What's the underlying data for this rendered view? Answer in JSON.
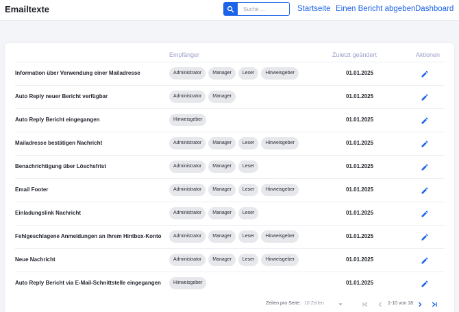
{
  "header": {
    "title": "Emailtexte",
    "search_placeholder": "Suche ...",
    "nav": [
      "Startseite",
      "Einen Bericht abgeben",
      "Dashboard"
    ]
  },
  "table": {
    "columns": {
      "recipients": "Empfänger",
      "last_changed": "Zuletzt geändert",
      "actions": "Aktionen"
    },
    "rows": [
      {
        "name": "Information über Verwendung einer Mailadresse",
        "recipients": [
          "Administrator",
          "Manager",
          "Leser",
          "Hinweisgeber"
        ],
        "date": "01.01.2025"
      },
      {
        "name": "Auto Reply neuer Bericht verfügbar",
        "recipients": [
          "Administrator",
          "Manager"
        ],
        "date": "01.01.2025"
      },
      {
        "name": "Auto Reply Bericht eingegangen",
        "recipients": [
          "Hinweisgeber"
        ],
        "date": "01.01.2025"
      },
      {
        "name": "Mailadresse bestätigen Nachricht",
        "recipients": [
          "Administrator",
          "Manager",
          "Leser",
          "Hinweisgeber"
        ],
        "date": "01.01.2025"
      },
      {
        "name": "Benachrichtigung über Löschsfrist",
        "recipients": [
          "Administrator",
          "Manager",
          "Leser"
        ],
        "date": "01.01.2025"
      },
      {
        "name": "Email Footer",
        "recipients": [
          "Administrator",
          "Manager",
          "Leser",
          "Hinweisgeber"
        ],
        "date": "01.01.2025"
      },
      {
        "name": "Einladungslink Nachricht",
        "recipients": [
          "Administrator",
          "Manager",
          "Leser"
        ],
        "date": "01.01.2025"
      },
      {
        "name": "Fehlgeschlagene Anmeldungen an Ihrem Hintbox-Konto",
        "recipients": [
          "Administrator",
          "Manager",
          "Leser",
          "Hinweisgeber"
        ],
        "date": "01.01.2025"
      },
      {
        "name": "Neue Nachricht",
        "recipients": [
          "Administrator",
          "Manager",
          "Leser",
          "Hinweisgeber"
        ],
        "date": "01.01.2025"
      },
      {
        "name": "Auto Reply Bericht via E-Mail-Schnittstelle eingegangen",
        "recipients": [
          "Hinweisgeber"
        ],
        "date": "01.01.2025"
      }
    ]
  },
  "pagination": {
    "rows_per_page_label": "Zeilen pro Seite:",
    "rows_per_page_value": "10 Zeilen",
    "range": "1-10 von 18"
  },
  "colors": {
    "accent": "#1d63e8",
    "header_text": "#9b9fc8",
    "chip_bg": "#e7e8ec"
  },
  "icons": [
    "search-icon",
    "pencil-icon",
    "chevron-down-icon",
    "first-page-icon",
    "prev-page-icon",
    "next-page-icon",
    "last-page-icon"
  ]
}
